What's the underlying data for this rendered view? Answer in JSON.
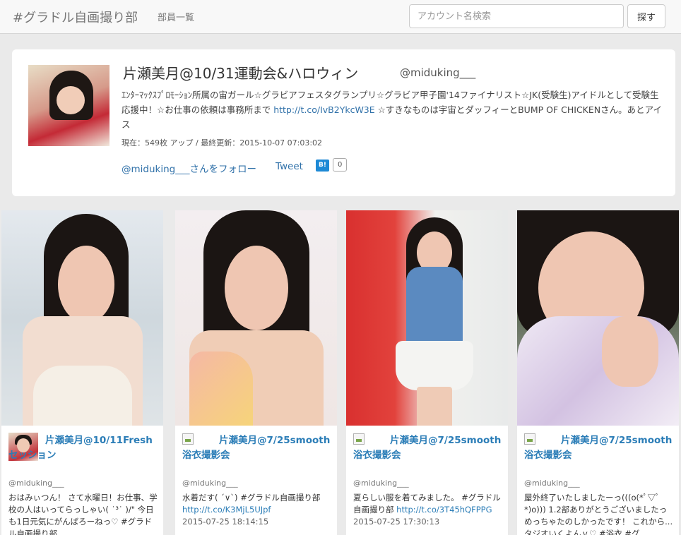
{
  "navbar": {
    "brand": "#グラドル自画撮り部",
    "members_link": "部員一覧",
    "search_placeholder": "アカウント名検索",
    "search_button": "探す"
  },
  "profile": {
    "name": "片瀬美月@10/31運動会&ハロウィン",
    "handle": "@miduking___",
    "bio_before_link": "ｴﾝﾀｰﾏｯｸｽﾌﾟﾛﾓｰｼｮﾝ所属の宙ガール☆グラビアフェスタグランプリ☆グラビア甲子園'14ファイナリスト☆JK(受験生)アイドルとして受験生応援中！☆お仕事の依頼は事務所まで ",
    "bio_link": "http://t.co/IvB2YkcW3E",
    "bio_after_link": " ☆すきなものは宇宙とダッフィーとBUMP OF CHICKENさん。あとアイス",
    "meta": "現在：549枚 アップ / 最終更新：2015-10-07 07:03:02",
    "follow_link": "@miduking___さんをフォロー",
    "tweet_link": "Tweet",
    "hatena_icon": "B!",
    "hatena_count": "0"
  },
  "cards": [
    {
      "title": "片瀬美月@10/11Freshセッション",
      "handle": "@miduking___",
      "text": "おはみぃつん！ さて水曜日！お仕事、学校の人はいってらっしゃい( ˙³˙ )/\" 今日も1日元気にがんばろーねっ♡ #グラドル自画撮り部",
      "link": "",
      "date": ""
    },
    {
      "title": "片瀬美月@7/25smooth浴衣撮影会",
      "handle": "@miduking___",
      "text": "水着だす( ´∨`) #グラドル自画撮り部 ",
      "link": "http://t.co/K3MjL5UJpf",
      "date": "2015-07-25 18:14:15"
    },
    {
      "title": "片瀬美月@7/25smooth浴衣撮影会",
      "handle": "@miduking___",
      "text": "夏らしい服を着てみました。 #グラドル自画撮り部 ",
      "link": "http://t.co/3T45hQFPPG",
      "date": "2015-07-25 17:30:13"
    },
    {
      "title": "片瀬美月@7/25smooth浴衣撮影会",
      "handle": "@miduking___",
      "text": "屋外終了いたしましたーっ(((o(*ﾟ▽ﾟ*)o))) 1.2部ありがとうございましたっ めっちゃたのしかったです！ これから...タジオいくよんｖ♡ #浴衣 #グ",
      "link": "",
      "date": ""
    }
  ],
  "colors": {
    "link": "#3071a9",
    "card_title": "#2b7db7",
    "page_bg": "#eaeaea"
  }
}
